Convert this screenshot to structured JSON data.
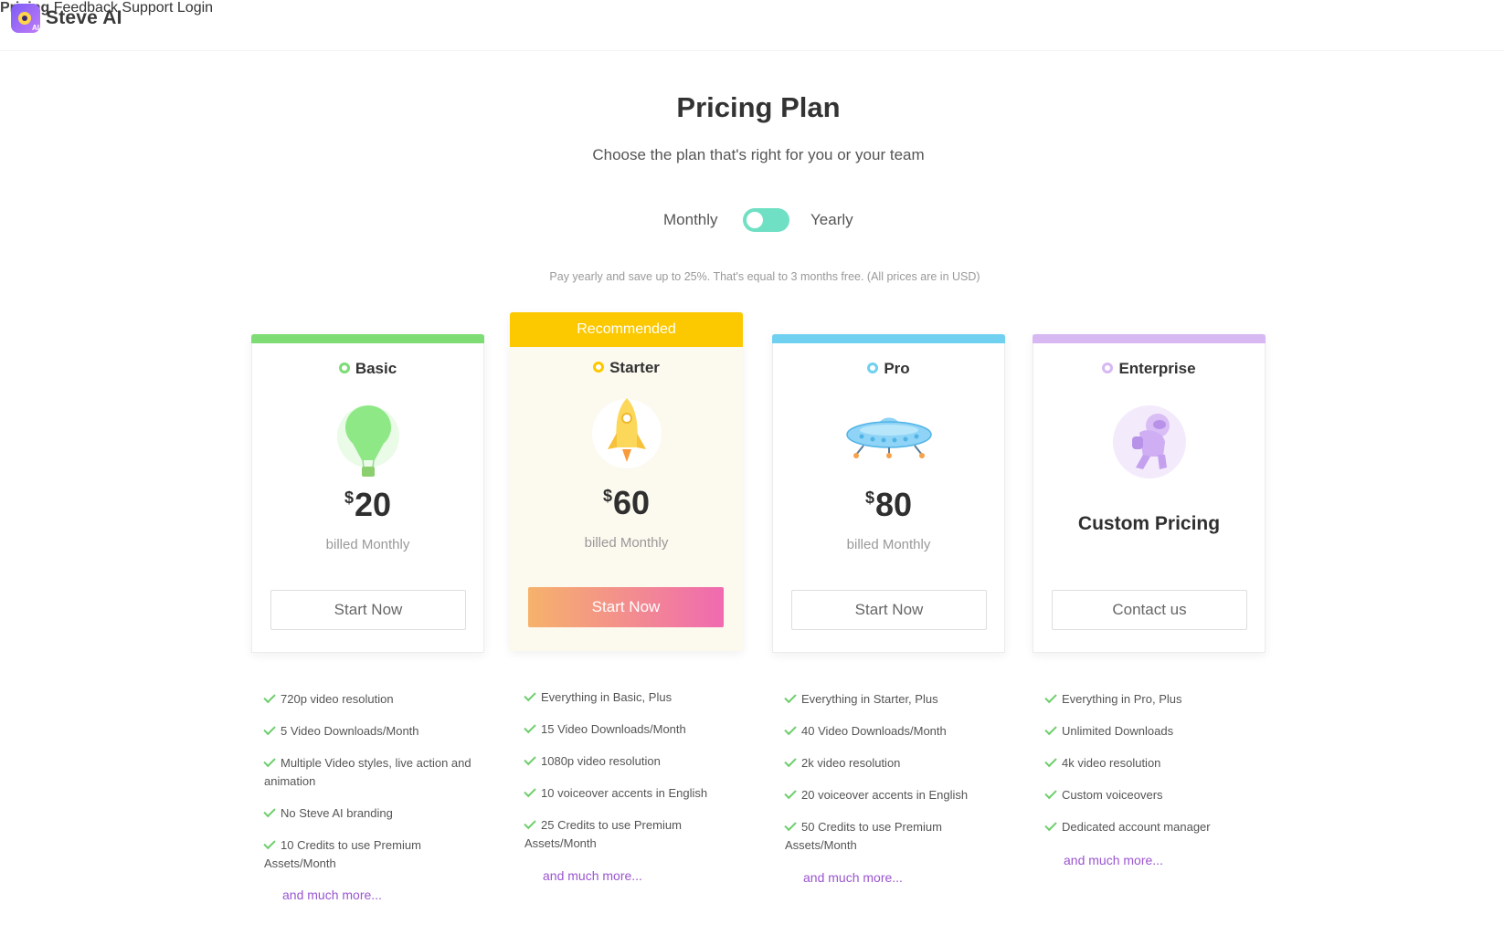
{
  "header": {
    "brand": "Steve AI",
    "logo_badge": "AI",
    "nav": [
      {
        "label": "Pricing",
        "active": true
      },
      {
        "label": "Feedback"
      },
      {
        "label": "Support"
      },
      {
        "label": "Login"
      }
    ]
  },
  "hero": {
    "title": "Pricing Plan",
    "subtitle": "Choose the plan that's right for you or your team",
    "toggle": {
      "left": "Monthly",
      "right": "Yearly",
      "selected": "Monthly"
    },
    "note": "Pay yearly and save up to 25%. That's equal to 3 months free. (All prices are in USD)"
  },
  "colors": {
    "basic": "#7ddc74",
    "starter": "#fcc800",
    "pro": "#6fd0f0",
    "enterprise": "#d7b8f3",
    "toggle": "#6fe0c4",
    "link": "#9a55d0",
    "check": "#6ccf6a"
  },
  "plans": [
    {
      "name": "Basic",
      "currency": "$",
      "price": "20",
      "billed": "billed Monthly",
      "cta": "Start Now",
      "icon": "hot-air-balloon",
      "features": [
        "720p video resolution",
        "5 Video Downloads/Month",
        "Multiple Video styles, live action and animation",
        "No Steve AI branding",
        "10 Credits to use Premium Assets/Month"
      ],
      "more": "and much more..."
    },
    {
      "name": "Starter",
      "badge": "Recommended",
      "currency": "$",
      "price": "60",
      "billed": "billed Monthly",
      "cta": "Start Now",
      "icon": "rocket",
      "features": [
        "Everything in Basic, Plus",
        "15 Video Downloads/Month",
        "1080p video resolution",
        "10 voiceover accents in English",
        "25 Credits to use Premium Assets/Month"
      ],
      "more": "and much more..."
    },
    {
      "name": "Pro",
      "currency": "$",
      "price": "80",
      "billed": "billed Monthly",
      "cta": "Start Now",
      "icon": "ufo",
      "features": [
        "Everything in Starter, Plus",
        "40 Video Downloads/Month",
        "2k video resolution",
        "20 voiceover accents in English",
        "50 Credits to use Premium Assets/Month"
      ],
      "more": "and much more..."
    },
    {
      "name": "Enterprise",
      "price_text": "Custom Pricing",
      "cta": "Contact us",
      "icon": "astronaut",
      "features": [
        "Everything in Pro, Plus",
        "Unlimited Downloads",
        "4k video resolution",
        "Custom voiceovers",
        "Dedicated account manager"
      ],
      "more": "and much more..."
    }
  ]
}
